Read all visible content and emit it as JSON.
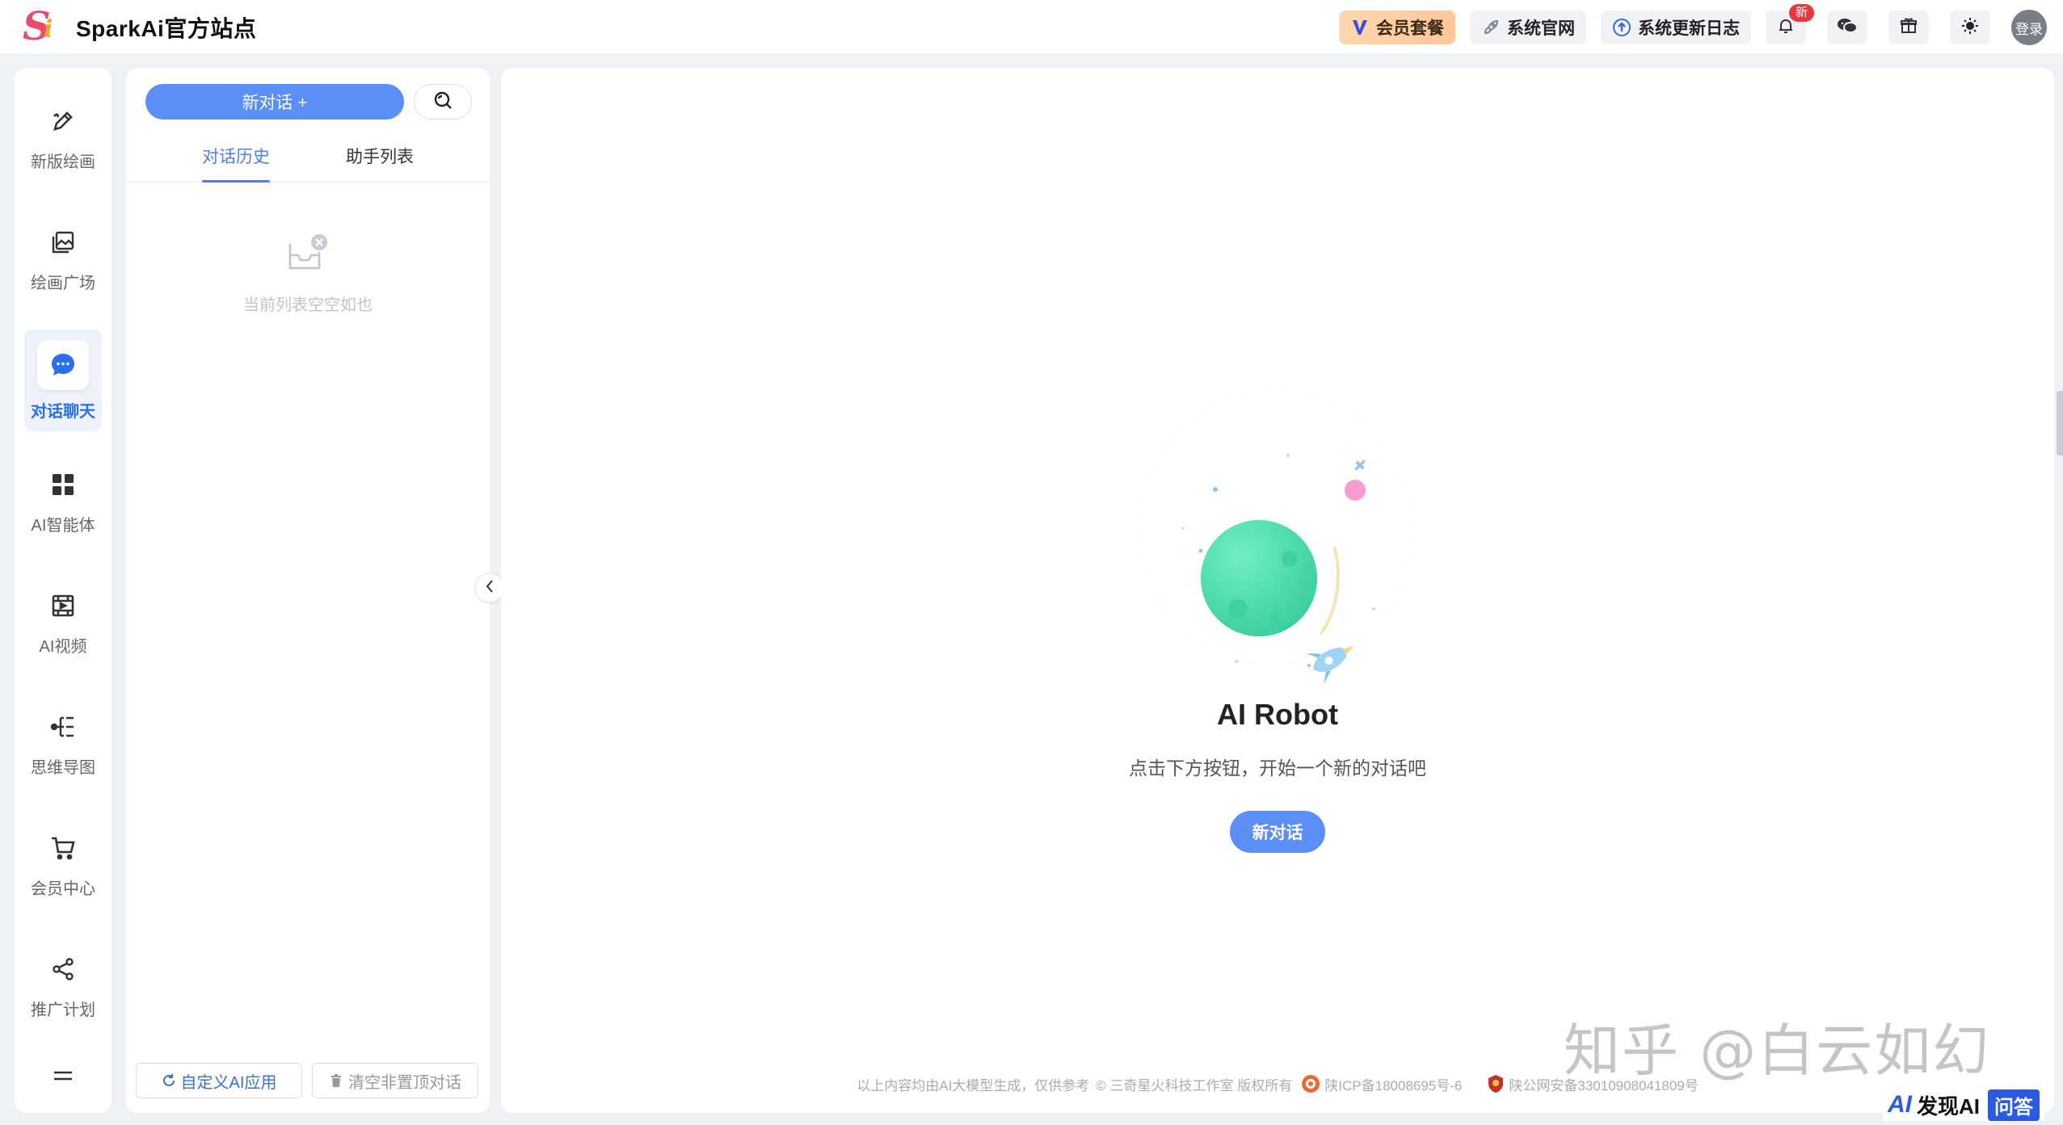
{
  "header": {
    "logo_text": "Si",
    "site_title": "SparkAi官方站点",
    "vip_label": "会员套餐",
    "official_site_label": "系统官网",
    "changelog_label": "系统更新日志",
    "notification_badge": "新",
    "login_label": "登录"
  },
  "sidebar": {
    "items": [
      {
        "label": "新版绘画",
        "icon": "pen-draw-icon"
      },
      {
        "label": "绘画广场",
        "icon": "image-gallery-icon"
      },
      {
        "label": "对话聊天",
        "icon": "chat-bubble-icon",
        "active": true
      },
      {
        "label": "AI智能体",
        "icon": "grid-apps-icon"
      },
      {
        "label": "AI视频",
        "icon": "video-icon"
      },
      {
        "label": "思维导图",
        "icon": "mindmap-icon"
      },
      {
        "label": "会员中心",
        "icon": "cart-icon"
      },
      {
        "label": "推广计划",
        "icon": "share-icon"
      }
    ]
  },
  "conversation": {
    "new_chat_label": "新对话 +",
    "tabs": [
      {
        "label": "对话历史",
        "active": true
      },
      {
        "label": "助手列表",
        "active": false
      }
    ],
    "empty_text": "当前列表空空如也",
    "custom_app_label": "自定义AI应用",
    "clear_label": "清空非置顶对话"
  },
  "main": {
    "title": "AI Robot",
    "subtitle": "点击下方按钮，开始一个新的对话吧",
    "start_button": "新对话"
  },
  "footer": {
    "disclaimer": "以上内容均由AI大模型生成，仅供参考",
    "copyright": "© 三奇星火科技工作室 版权所有",
    "icp": "陕ICP备18008695号-6",
    "police": "陕公网安备33010908041809号"
  },
  "watermark": {
    "text": "知乎 @白云如幻"
  },
  "brand_badge": {
    "mark": "AI",
    "name": "发现AI",
    "tag": "问答"
  },
  "colors": {
    "accent": "#5b8ff5",
    "active_text": "#2a6ff0",
    "vip_bg": "#ffc79a",
    "badge": "#e8383d",
    "planet": "#4fe3b0"
  }
}
